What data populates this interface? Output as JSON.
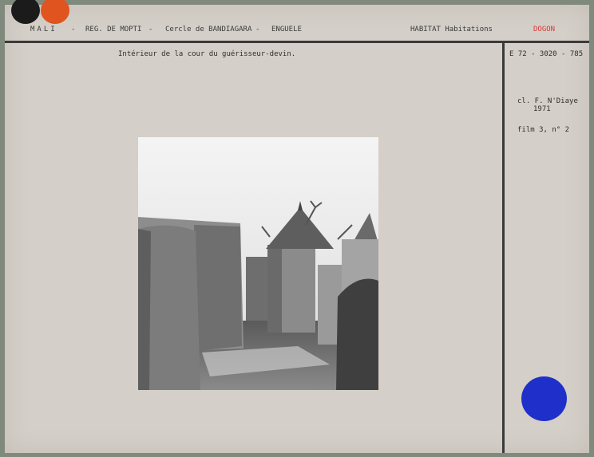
{
  "header": {
    "country": "MALI",
    "region": "REG. DE MOPTI",
    "cercle": "Cercle de BANDIAGARA",
    "village": "ENGUELE",
    "theme": "HABITAT Habitations",
    "ethnic_group": "DOGON",
    "separator": "-"
  },
  "caption": "Intérieur de la cour du guérisseur-devin.",
  "reference": "E 72 - 3020 - 785",
  "credit": "cl. F. N'Diaye",
  "credit_year": "1971",
  "film": "film 3, n° 2",
  "colors": {
    "card": "#d4cfc8",
    "ink": "#3a3a3a",
    "ethnic_red": "#d8393a",
    "dot_black": "#1b1b1b",
    "dot_orange": "#e0541f",
    "dot_blue": "#1f2fc9"
  }
}
